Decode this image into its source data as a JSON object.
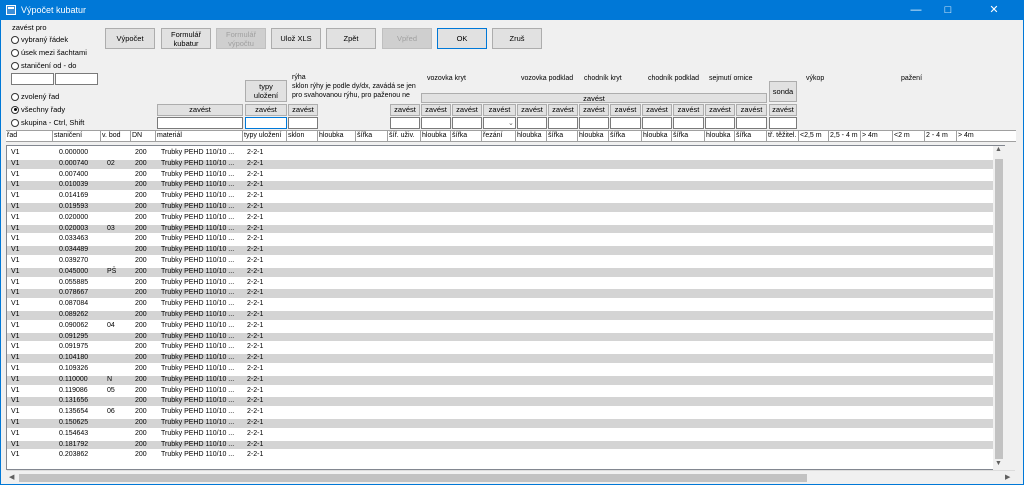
{
  "window": {
    "title": "Výpočet kubatur",
    "min": "—",
    "max": "□",
    "close": "✕"
  },
  "left": {
    "group_label": "zavést pro",
    "radios": [
      {
        "label": "vybraný řádek",
        "checked": false
      },
      {
        "label": "úsek mezi šachtami",
        "checked": false
      },
      {
        "label": "staničení od - do",
        "checked": false
      },
      {
        "label": "zvolený řad",
        "checked": false
      },
      {
        "label": "všechny řady",
        "checked": true
      },
      {
        "label": "skupina - Ctrl, Shift",
        "checked": false
      }
    ]
  },
  "toolbar": {
    "vypocet": "Výpočet",
    "formular_kubatur_1": "Formulář",
    "formular_kubatur_2": "kubatur",
    "formular_vypoctu_1": "Formulář",
    "formular_vypoctu_2": "výpočtu",
    "uloz_xls": "Ulož XLS",
    "zpet": "Zpět",
    "vpred": "Vpřed",
    "ok": "OK",
    "zrus": "Zruš"
  },
  "params": {
    "typy_ulozeni_1": "typy",
    "typy_ulozeni_2": "uložení",
    "ryha": "rýha",
    "ryha_note1": "sklon rýhy je podle dy/dx, zavádá se jen",
    "ryha_note2": "pro svahovanou rýhu, pro paženou ne",
    "vozovka_kryt": "vozovka kryt",
    "vozovka_podklad": "vozovka podklad",
    "chodnik_kryt": "chodník kryt",
    "chodnik_podklad": "chodník podklad",
    "sejmuti_ornice": "sejmutí ornice",
    "vykop": "výkop",
    "pazeni": "pažení",
    "zavest": "zavést",
    "sonda": "sonda"
  },
  "columns": [
    "řad",
    "staničení",
    "v. bod",
    "DN",
    "materiál",
    "typy uložení",
    "sklon",
    "hloubka",
    "šířka",
    "šíř. uživ.",
    "hloubka",
    "šířka",
    "řezání",
    "hloubka",
    "šířka",
    "hloubka",
    "šířka",
    "hloubka",
    "šířka",
    "hloubka",
    "šířka",
    "tř. těžitel.",
    "<2,5 m",
    "2,5 - 4 m",
    "> 4m",
    "<2 m",
    "2 - 4 m",
    "> 4m"
  ],
  "rows": [
    [
      "V1",
      "0.000000",
      "",
      "200",
      "Trubky PEHD 110/10 ...",
      "2-2-1"
    ],
    [
      "V1",
      "0.000740",
      "02",
      "200",
      "Trubky PEHD 110/10 ...",
      "2-2-1"
    ],
    [
      "V1",
      "0.007400",
      "",
      "200",
      "Trubky PEHD 110/10 ...",
      "2-2-1"
    ],
    [
      "V1",
      "0.010039",
      "",
      "200",
      "Trubky PEHD 110/10 ...",
      "2-2-1"
    ],
    [
      "V1",
      "0.014169",
      "",
      "200",
      "Trubky PEHD 110/10 ...",
      "2-2-1"
    ],
    [
      "V1",
      "0.019593",
      "",
      "200",
      "Trubky PEHD 110/10 ...",
      "2-2-1"
    ],
    [
      "V1",
      "0.020000",
      "",
      "200",
      "Trubky PEHD 110/10 ...",
      "2-2-1"
    ],
    [
      "V1",
      "0.020003",
      "03",
      "200",
      "Trubky PEHD 110/10 ...",
      "2-2-1"
    ],
    [
      "V1",
      "0.033463",
      "",
      "200",
      "Trubky PEHD 110/10 ...",
      "2-2-1"
    ],
    [
      "V1",
      "0.034489",
      "",
      "200",
      "Trubky PEHD 110/10 ...",
      "2-2-1"
    ],
    [
      "V1",
      "0.039270",
      "",
      "200",
      "Trubky PEHD 110/10 ...",
      "2-2-1"
    ],
    [
      "V1",
      "0.045000",
      "PŠ",
      "200",
      "Trubky PEHD 110/10 ...",
      "2-2-1"
    ],
    [
      "V1",
      "0.055885",
      "",
      "200",
      "Trubky PEHD 110/10 ...",
      "2-2-1"
    ],
    [
      "V1",
      "0.078667",
      "",
      "200",
      "Trubky PEHD 110/10 ...",
      "2-2-1"
    ],
    [
      "V1",
      "0.087084",
      "",
      "200",
      "Trubky PEHD 110/10 ...",
      "2-2-1"
    ],
    [
      "V1",
      "0.089262",
      "",
      "200",
      "Trubky PEHD 110/10 ...",
      "2-2-1"
    ],
    [
      "V1",
      "0.090062",
      "04",
      "200",
      "Trubky PEHD 110/10 ...",
      "2-2-1"
    ],
    [
      "V1",
      "0.091295",
      "",
      "200",
      "Trubky PEHD 110/10 ...",
      "2-2-1"
    ],
    [
      "V1",
      "0.091975",
      "",
      "200",
      "Trubky PEHD 110/10 ...",
      "2-2-1"
    ],
    [
      "V1",
      "0.104180",
      "",
      "200",
      "Trubky PEHD 110/10 ...",
      "2-2-1"
    ],
    [
      "V1",
      "0.109326",
      "",
      "200",
      "Trubky PEHD 110/10 ...",
      "2-2-1"
    ],
    [
      "V1",
      "0.110000",
      "N",
      "200",
      "Trubky PEHD 110/10 ...",
      "2-2-1"
    ],
    [
      "V1",
      "0.119086",
      "05",
      "200",
      "Trubky PEHD 110/10 ...",
      "2-2-1"
    ],
    [
      "V1",
      "0.131656",
      "",
      "200",
      "Trubky PEHD 110/10 ...",
      "2-2-1"
    ],
    [
      "V1",
      "0.135654",
      "06",
      "200",
      "Trubky PEHD 110/10 ...",
      "2-2-1"
    ],
    [
      "V1",
      "0.150625",
      "",
      "200",
      "Trubky PEHD 110/10 ...",
      "2-2-1"
    ],
    [
      "V1",
      "0.154643",
      "",
      "200",
      "Trubky PEHD 110/10 ...",
      "2-2-1"
    ],
    [
      "V1",
      "0.181792",
      "",
      "200",
      "Trubky PEHD 110/10 ...",
      "2-2-1"
    ],
    [
      "V1",
      "0.203862",
      "",
      "200",
      "Trubky PEHD 110/10 ...",
      "2-2-1"
    ]
  ]
}
